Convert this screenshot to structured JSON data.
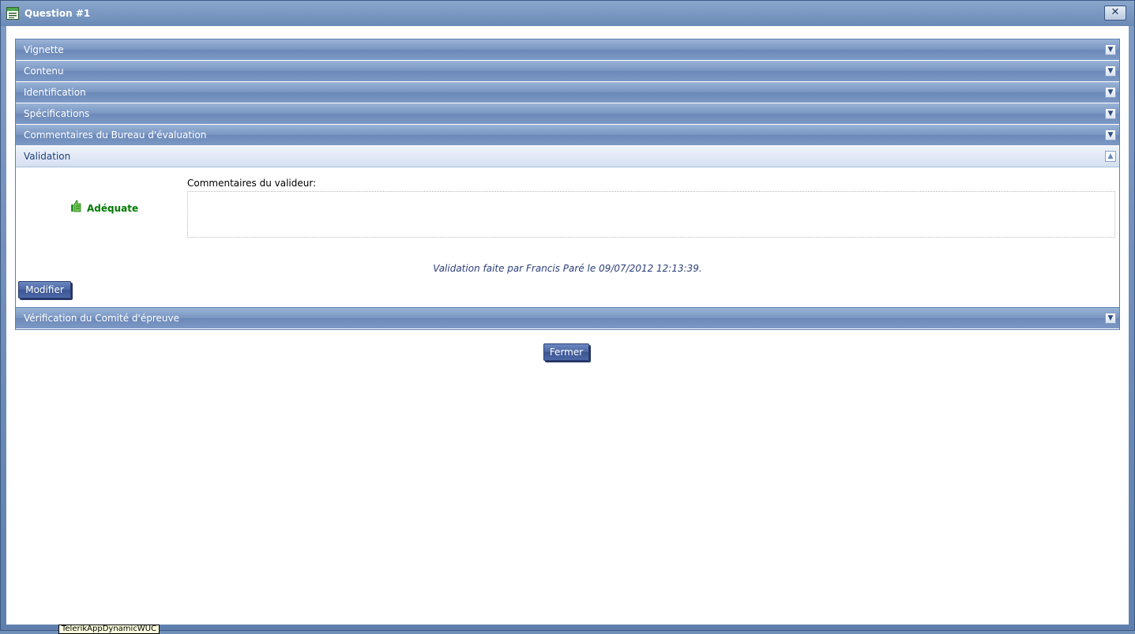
{
  "window": {
    "title": "Question #1",
    "close_label": "✕"
  },
  "panels": [
    {
      "label": "Vignette",
      "expanded": false
    },
    {
      "label": "Contenu",
      "expanded": false
    },
    {
      "label": "Identification",
      "expanded": false
    },
    {
      "label": "Spécifications",
      "expanded": false
    },
    {
      "label": "Commentaires du Bureau d'évaluation",
      "expanded": false
    },
    {
      "label": "Validation",
      "expanded": true
    },
    {
      "label": "Vérification du Comité d'épreuve",
      "expanded": false
    }
  ],
  "validation": {
    "status": "Adéquate",
    "comments_label": "Commentaires du valideur:",
    "comments_value": "",
    "info": "Validation faite par Francis Paré le 09/07/2012 12:13:39.",
    "modify_label": "Modifier"
  },
  "footer": {
    "close_label": "Fermer"
  },
  "tooltip": "TelerikAppDynamicWUC",
  "colors": {
    "status_green": "#007a00",
    "header_blue": "#7895c2",
    "info_text": "#2b3f7a"
  },
  "icons": {
    "window": "window-icon",
    "close": "close-icon",
    "expand": "chevron-down-icon",
    "collapse": "chevron-up-icon",
    "status": "thumbs-up-icon"
  }
}
